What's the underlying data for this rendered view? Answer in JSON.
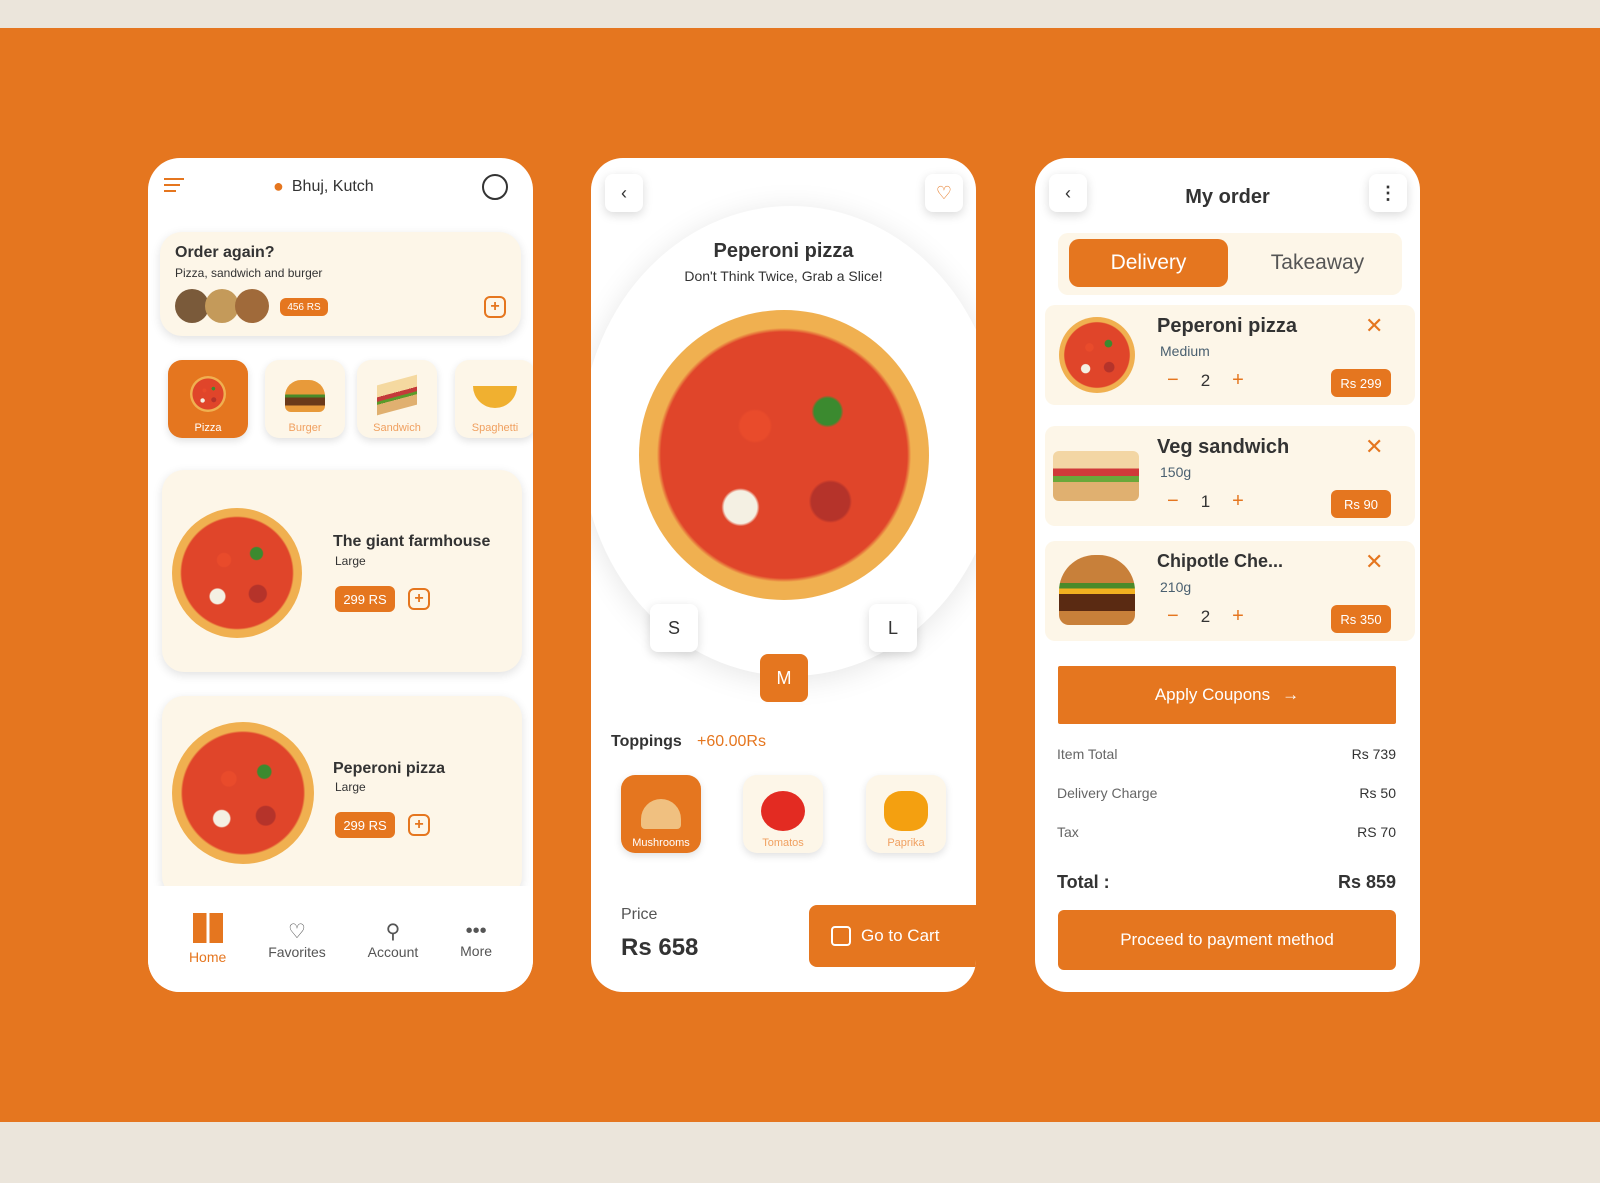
{
  "colors": {
    "accent": "#e5761f",
    "cream": "#fdf6e8"
  },
  "home": {
    "location": "Bhuj, Kutch",
    "order_again": {
      "title": "Order again?",
      "subtitle": "Pizza, sandwich and burger",
      "price": "456 RS"
    },
    "categories": [
      "Pizza",
      "Burger",
      "Sandwich",
      "Spaghetti"
    ],
    "items": [
      {
        "name": "The  giant farmhouse",
        "size": "Large",
        "price": "299 RS"
      },
      {
        "name": "Peperoni pizza",
        "size": "Large",
        "price": "299 RS"
      }
    ],
    "nav": [
      "Home",
      "Favorites",
      "Account",
      "More"
    ]
  },
  "detail": {
    "title": "Peperoni pizza",
    "tagline": "Don't Think Twice, Grab a Slice!",
    "sizes": [
      "S",
      "M",
      "L"
    ],
    "selected_size": "M",
    "toppings_label": "Toppings",
    "toppings_price": "+60.00Rs",
    "toppings": [
      "Mushrooms",
      "Tomatos",
      "Paprika"
    ],
    "price_label": "Price",
    "price": "Rs 658",
    "cart_button": "Go  to Cart"
  },
  "order": {
    "title": "My order",
    "tabs": [
      "Delivery",
      "Takeaway"
    ],
    "items": [
      {
        "name": "Peperoni pizza",
        "variant": "Medium",
        "qty": "2",
        "price": "Rs 299"
      },
      {
        "name": "Veg sandwich",
        "variant": "150g",
        "qty": "1",
        "price": "Rs 90"
      },
      {
        "name": "Chipotle Che...",
        "variant": "210g",
        "qty": "2",
        "price": "Rs 350"
      }
    ],
    "coupon_button": "Apply Coupons",
    "summary": [
      {
        "label": "Item Total",
        "value": "Rs 739"
      },
      {
        "label": "Delivery Charge",
        "value": "Rs 50"
      },
      {
        "label": "Tax",
        "value": "RS 70"
      }
    ],
    "total_label": "Total :",
    "total": "Rs 859",
    "pay_button": "Proceed to payment method"
  }
}
